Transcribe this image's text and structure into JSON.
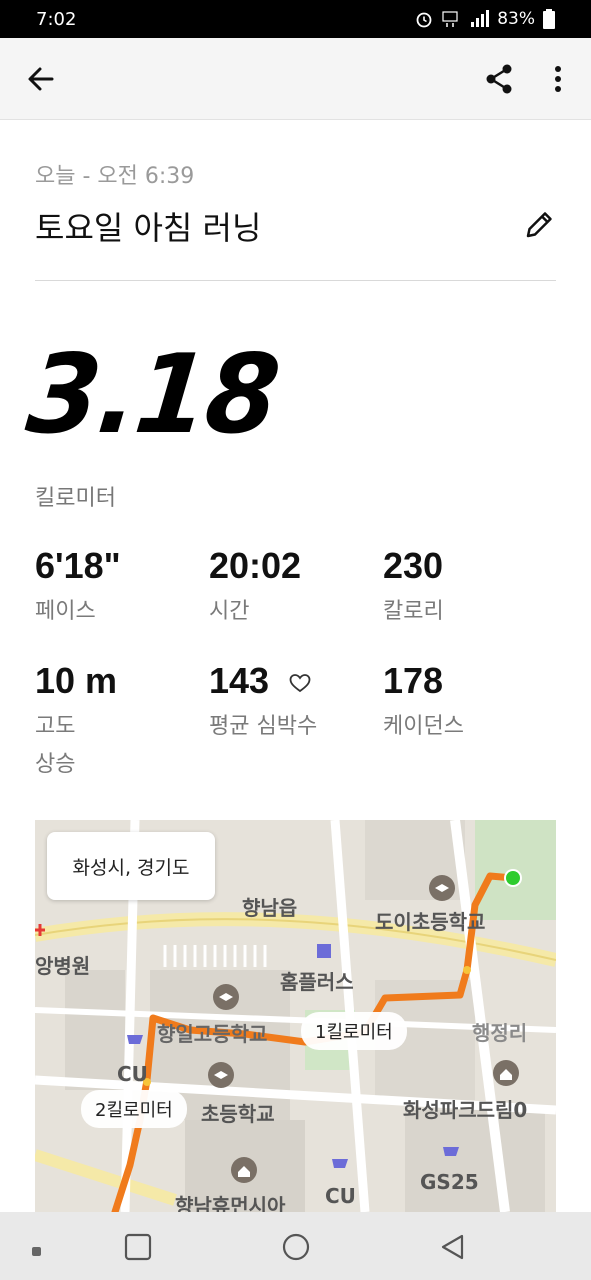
{
  "status_bar": {
    "time": "7:02",
    "battery": "83%"
  },
  "activity": {
    "date": "오늘 - 오전 6:39",
    "title": "토요일 아침 러닝",
    "distance": "3.18",
    "distance_unit": "킬로미터"
  },
  "stats": [
    {
      "value": "6'18\"",
      "label": "페이스"
    },
    {
      "value": "20:02",
      "label": "시간"
    },
    {
      "value": "230",
      "label": "칼로리"
    },
    {
      "value": "10 m",
      "label": "고도\n상승"
    },
    {
      "value": "143",
      "label": "평균 심박수"
    },
    {
      "value": "178",
      "label": "케이던스"
    }
  ],
  "map": {
    "city": "화성시, 경기도",
    "km1": "1킬로미터",
    "km2": "2킬로미터",
    "labels": {
      "hyangnam": "향남읍",
      "doi_school": "도이초등학교",
      "homeplus": "홈플러스",
      "hyangil_high": "향일고등학교",
      "haengjeongri": "행정리",
      "elementary": "초등학교",
      "hwaseong_park": "화성파크드림0",
      "gs25": "GS25",
      "cu1": "CU",
      "cu2": "CU",
      "hyangnam_human": "향남휴먼시아",
      "hospital": "앙병원"
    },
    "route_color": "#f07b1c",
    "start_color": "#2ecc2e"
  }
}
